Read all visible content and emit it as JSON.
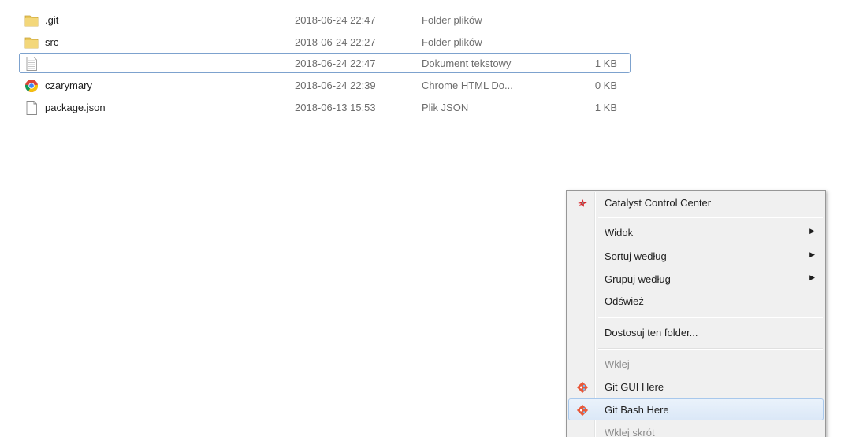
{
  "files": [
    {
      "name": ".git",
      "date": "2018-06-24 22:47",
      "type": "Folder plików",
      "size": "",
      "icon": "folder-icon"
    },
    {
      "name": "src",
      "date": "2018-06-24 22:27",
      "type": "Folder plików",
      "size": "",
      "icon": "folder-icon"
    },
    {
      "name": "",
      "date": "2018-06-24 22:47",
      "type": "Dokument tekstowy",
      "size": "1 KB",
      "icon": "text-document-icon"
    },
    {
      "name": "czarymary",
      "date": "2018-06-24 22:39",
      "type": "Chrome HTML Do...",
      "size": "0 KB",
      "icon": "chrome-icon"
    },
    {
      "name": "package.json",
      "date": "2018-06-13 15:53",
      "type": "Plik JSON",
      "size": "1 KB",
      "icon": "blank-file-icon"
    }
  ],
  "context_menu": {
    "items": [
      {
        "label": "Catalyst Control Center",
        "icon": "catalyst-icon",
        "submenu": false,
        "disabled": false
      },
      {
        "label": "Widok",
        "submenu": true,
        "disabled": false
      },
      {
        "label": "Sortuj według",
        "submenu": true,
        "disabled": false
      },
      {
        "label": "Grupuj według",
        "submenu": true,
        "disabled": false
      },
      {
        "label": "Odśwież",
        "submenu": false,
        "disabled": false
      },
      {
        "label": "Dostosuj ten folder...",
        "submenu": false,
        "disabled": false
      },
      {
        "label": "Wklej",
        "submenu": false,
        "disabled": true
      },
      {
        "label": "Git GUI Here",
        "icon": "git-icon",
        "submenu": false,
        "disabled": false
      },
      {
        "label": "Git Bash Here",
        "icon": "git-icon",
        "submenu": false,
        "disabled": false,
        "highlighted": true
      },
      {
        "label": "Wklej skrót",
        "submenu": false,
        "disabled": true
      }
    ]
  },
  "colors": {
    "folder": "#e8c65a",
    "selection_border": "#7da2ce",
    "menu_background": "#f0f0f0",
    "hover_border": "#a8c8ec"
  }
}
